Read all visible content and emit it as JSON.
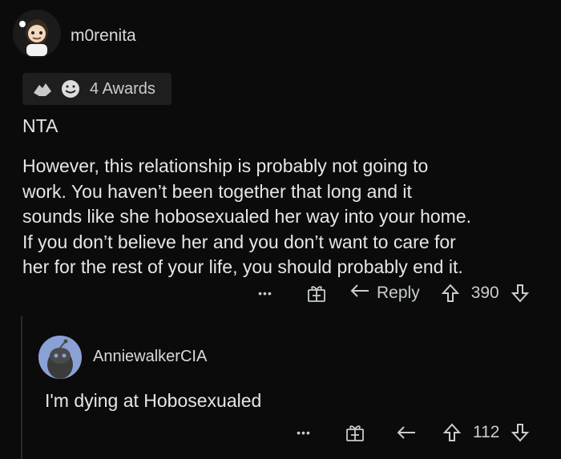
{
  "comment": {
    "username": "m0renita",
    "awards_label": "4 Awards",
    "title": "NTA",
    "paragraph_lines": [
      "However, this relationship is probably not going to",
      "work. You haven’t been together that long and it",
      "sounds like she hobosexualed her way into your home.",
      "If you don’t believe her and you don’t want to care for",
      "her for the rest of your life, you should probably end it."
    ],
    "more": "•••",
    "reply_label": "Reply",
    "score": "390"
  },
  "reply": {
    "username": "AnniewalkerCIA",
    "text": "I'm dying at Hobosexualed",
    "more": "•••",
    "score": "112"
  },
  "colors": {
    "bg": "#0b0b0b",
    "text": "#d7dadc",
    "avatar_bg": "#8aa1d6"
  },
  "icons": [
    "avatar",
    "award-icon-hands",
    "award-icon-smile",
    "gift-icon",
    "reply-arrow-icon",
    "upvote-icon",
    "downvote-icon",
    "more-icon"
  ]
}
